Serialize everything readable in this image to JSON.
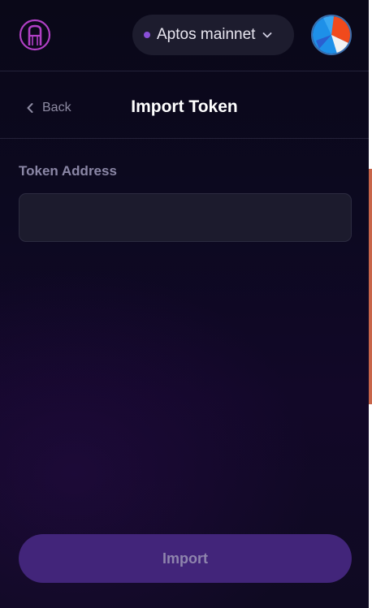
{
  "header": {
    "logo_icon": "bridge-logo-icon",
    "network": {
      "label": "Aptos mainnet",
      "status_color": "#8a4fd8",
      "dropdown_icon": "chevron-down-icon"
    },
    "avatar_icon": "account-avatar-icon"
  },
  "subheader": {
    "back_label": "Back",
    "back_icon": "chevron-left-icon",
    "title": "Import Token"
  },
  "form": {
    "token_address_label": "Token Address",
    "token_address_value": "",
    "token_address_placeholder": ""
  },
  "actions": {
    "import_label": "Import"
  },
  "colors": {
    "background": "#0c0920",
    "accent": "#42257a",
    "input_bg": "#1c1b2d",
    "pill_bg": "#1d1c2e"
  }
}
